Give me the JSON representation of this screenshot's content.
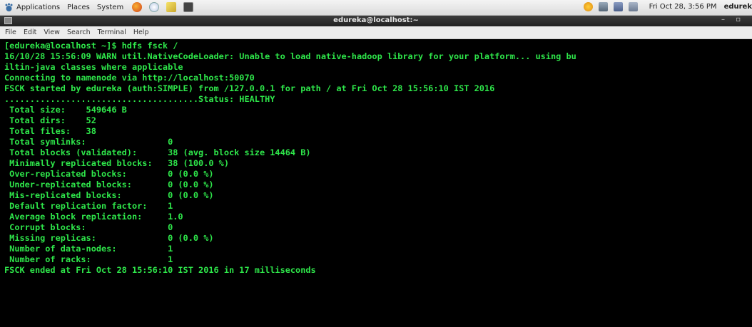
{
  "topbar": {
    "menus": [
      "Applications",
      "Places",
      "System"
    ],
    "clock": "Fri Oct 28,  3:56 PM",
    "user": "edurek"
  },
  "window": {
    "title": "edureka@localhost:~",
    "controls": "– ▫"
  },
  "menubar": [
    "File",
    "Edit",
    "View",
    "Search",
    "Terminal",
    "Help"
  ],
  "terminal": {
    "lines": [
      "[edureka@localhost ~]$ hdfs fsck /",
      "16/10/28 15:56:09 WARN util.NativeCodeLoader: Unable to load native-hadoop library for your platform... using bu",
      "iltin-java classes where applicable",
      "Connecting to namenode via http://localhost:50070",
      "FSCK started by edureka (auth:SIMPLE) from /127.0.0.1 for path / at Fri Oct 28 15:56:10 IST 2016",
      "......................................Status: HEALTHY",
      " Total size:    549646 B",
      " Total dirs:    52",
      " Total files:   38",
      " Total symlinks:                0",
      " Total blocks (validated):      38 (avg. block size 14464 B)",
      " Minimally replicated blocks:   38 (100.0 %)",
      " Over-replicated blocks:        0 (0.0 %)",
      " Under-replicated blocks:       0 (0.0 %)",
      " Mis-replicated blocks:         0 (0.0 %)",
      " Default replication factor:    1",
      " Average block replication:     1.0",
      " Corrupt blocks:                0",
      " Missing replicas:              0 (0.0 %)",
      " Number of data-nodes:          1",
      " Number of racks:               1",
      "FSCK ended at Fri Oct 28 15:56:10 IST 2016 in 17 milliseconds"
    ]
  },
  "colors": {
    "terminal_bg": "#000000",
    "terminal_fg": "#2ee64a"
  }
}
